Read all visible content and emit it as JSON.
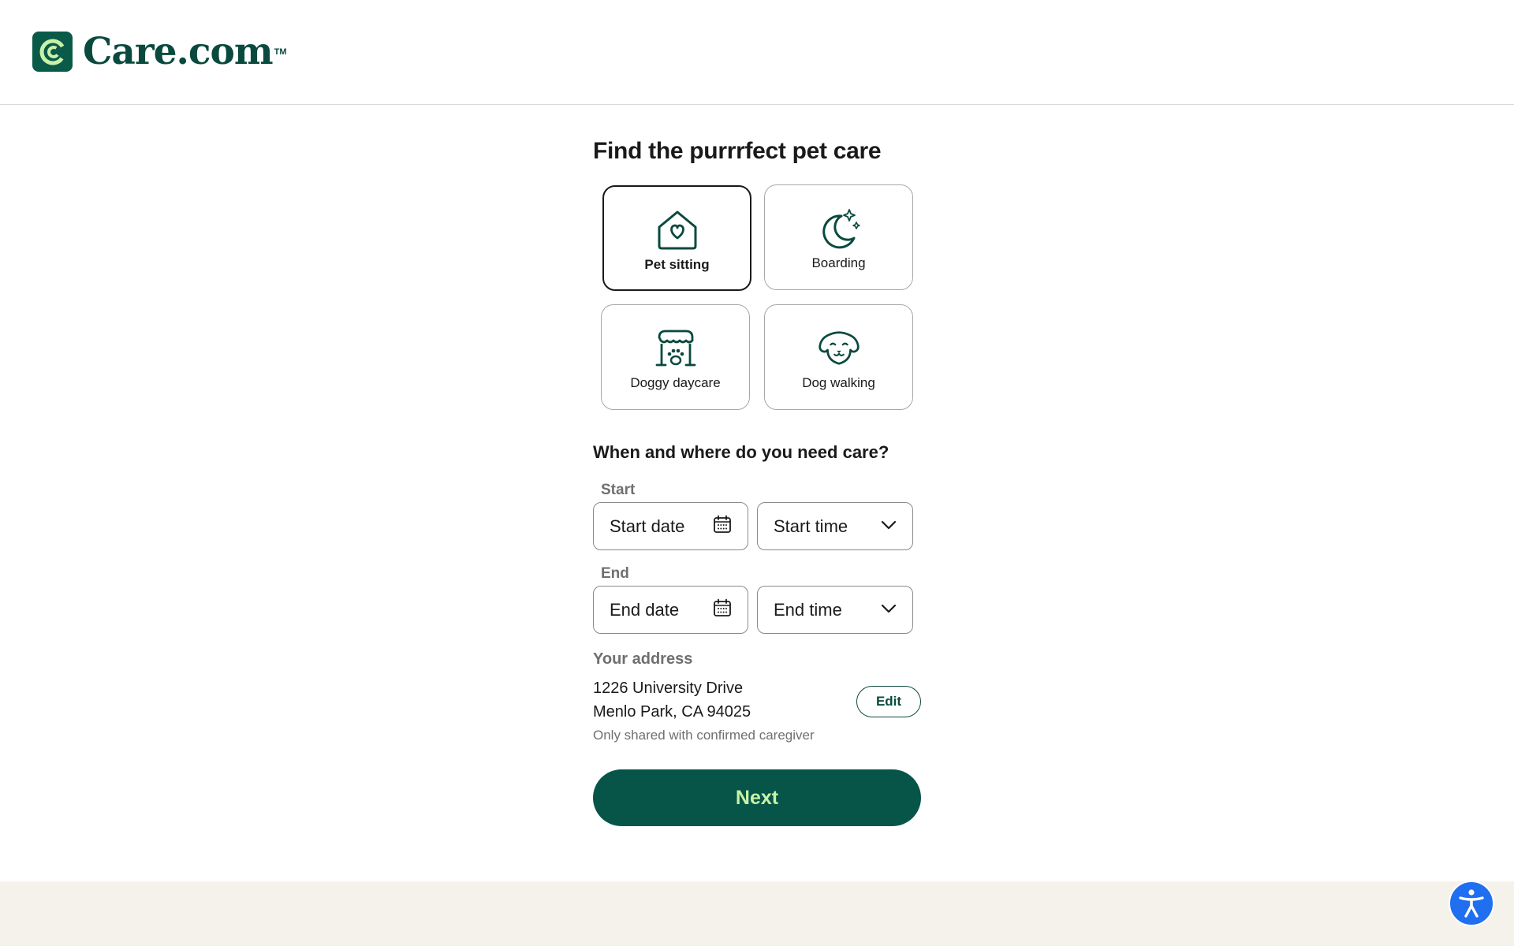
{
  "header": {
    "brand": "Care.com",
    "trademark": "TM"
  },
  "main": {
    "title": "Find the purrrfect pet care",
    "services": [
      {
        "label": "Pet sitting",
        "icon": "house-heart-icon",
        "selected": true
      },
      {
        "label": "Boarding",
        "icon": "moon-stars-icon",
        "selected": false
      },
      {
        "label": "Doggy daycare",
        "icon": "storefront-paw-icon",
        "selected": false
      },
      {
        "label": "Dog walking",
        "icon": "dog-face-icon",
        "selected": false
      }
    ],
    "schedule_title": "When and where do you need care?",
    "start": {
      "label": "Start",
      "date_placeholder": "Start date",
      "time_placeholder": "Start time"
    },
    "end": {
      "label": "End",
      "date_placeholder": "End date",
      "time_placeholder": "End time"
    },
    "address": {
      "label": "Your address",
      "line1": "1226 University Drive",
      "line2": "Menlo Park, CA 94025",
      "note": "Only shared with confirmed caregiver",
      "edit_label": "Edit"
    },
    "next_label": "Next"
  },
  "colors": {
    "brand_green": "#0a5a49",
    "button_green": "#065548",
    "button_text": "#c9f2a8",
    "accessibility_blue": "#1f6ff0",
    "footer_band": "#f5f2ec"
  }
}
